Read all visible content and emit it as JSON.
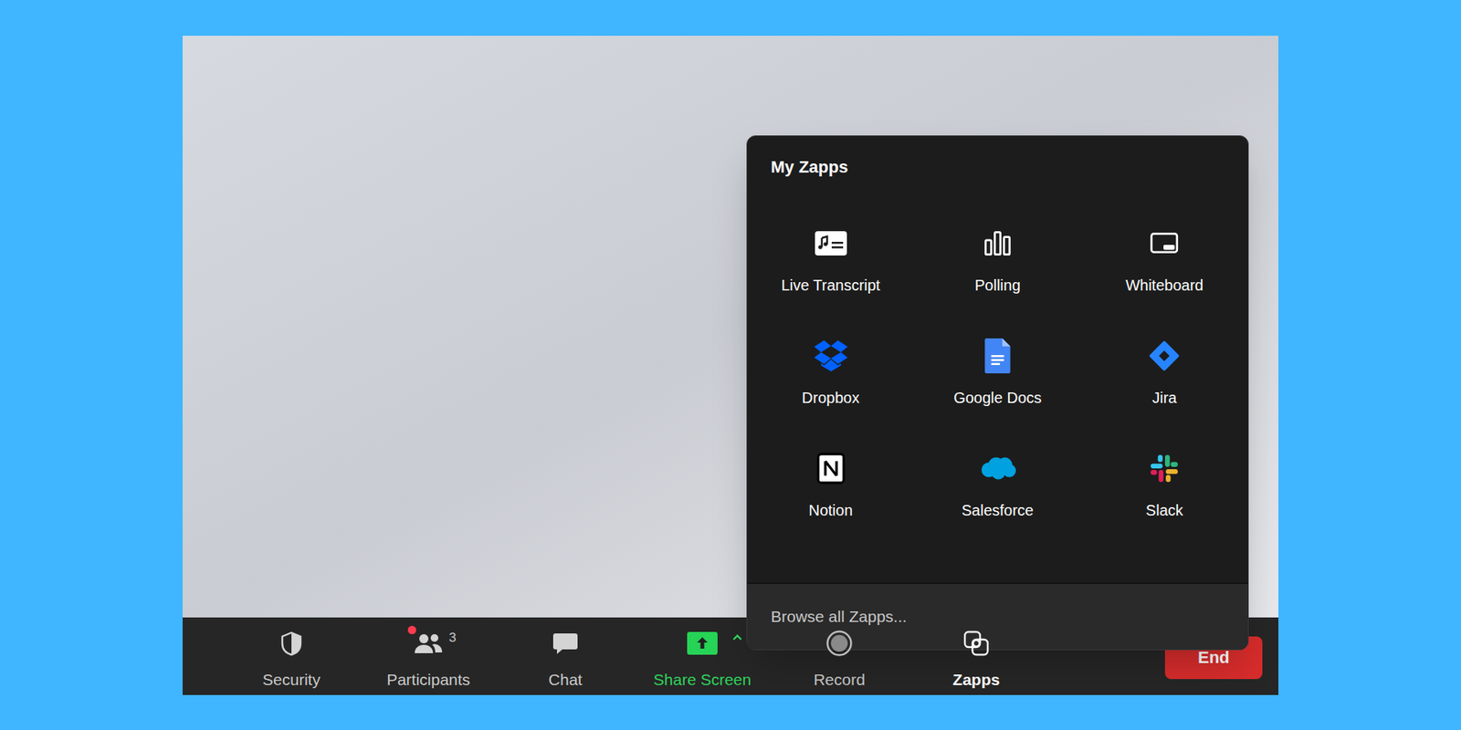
{
  "menu": {
    "title": "My Zapps",
    "items": [
      {
        "label": "Live Transcript"
      },
      {
        "label": "Polling"
      },
      {
        "label": "Whiteboard"
      },
      {
        "label": "Dropbox"
      },
      {
        "label": "Google Docs"
      },
      {
        "label": "Jira"
      },
      {
        "label": "Notion"
      },
      {
        "label": "Salesforce"
      },
      {
        "label": "Slack"
      }
    ],
    "footer": "Browse all Zapps..."
  },
  "toolbar": {
    "items": [
      {
        "label": "Security",
        "kind": "button",
        "selected": false,
        "notification": false
      },
      {
        "label": "Participants",
        "kind": "button",
        "selected": false,
        "notification": true,
        "count": "3"
      },
      {
        "label": "Chat",
        "kind": "button",
        "selected": false,
        "notification": false
      },
      {
        "label": "Share Screen",
        "kind": "share",
        "selected": false,
        "notification": false
      },
      {
        "label": "Record",
        "kind": "button",
        "selected": false,
        "notification": false
      },
      {
        "label": "Zapps",
        "kind": "button",
        "selected": true,
        "notification": false
      }
    ],
    "end": "End"
  }
}
